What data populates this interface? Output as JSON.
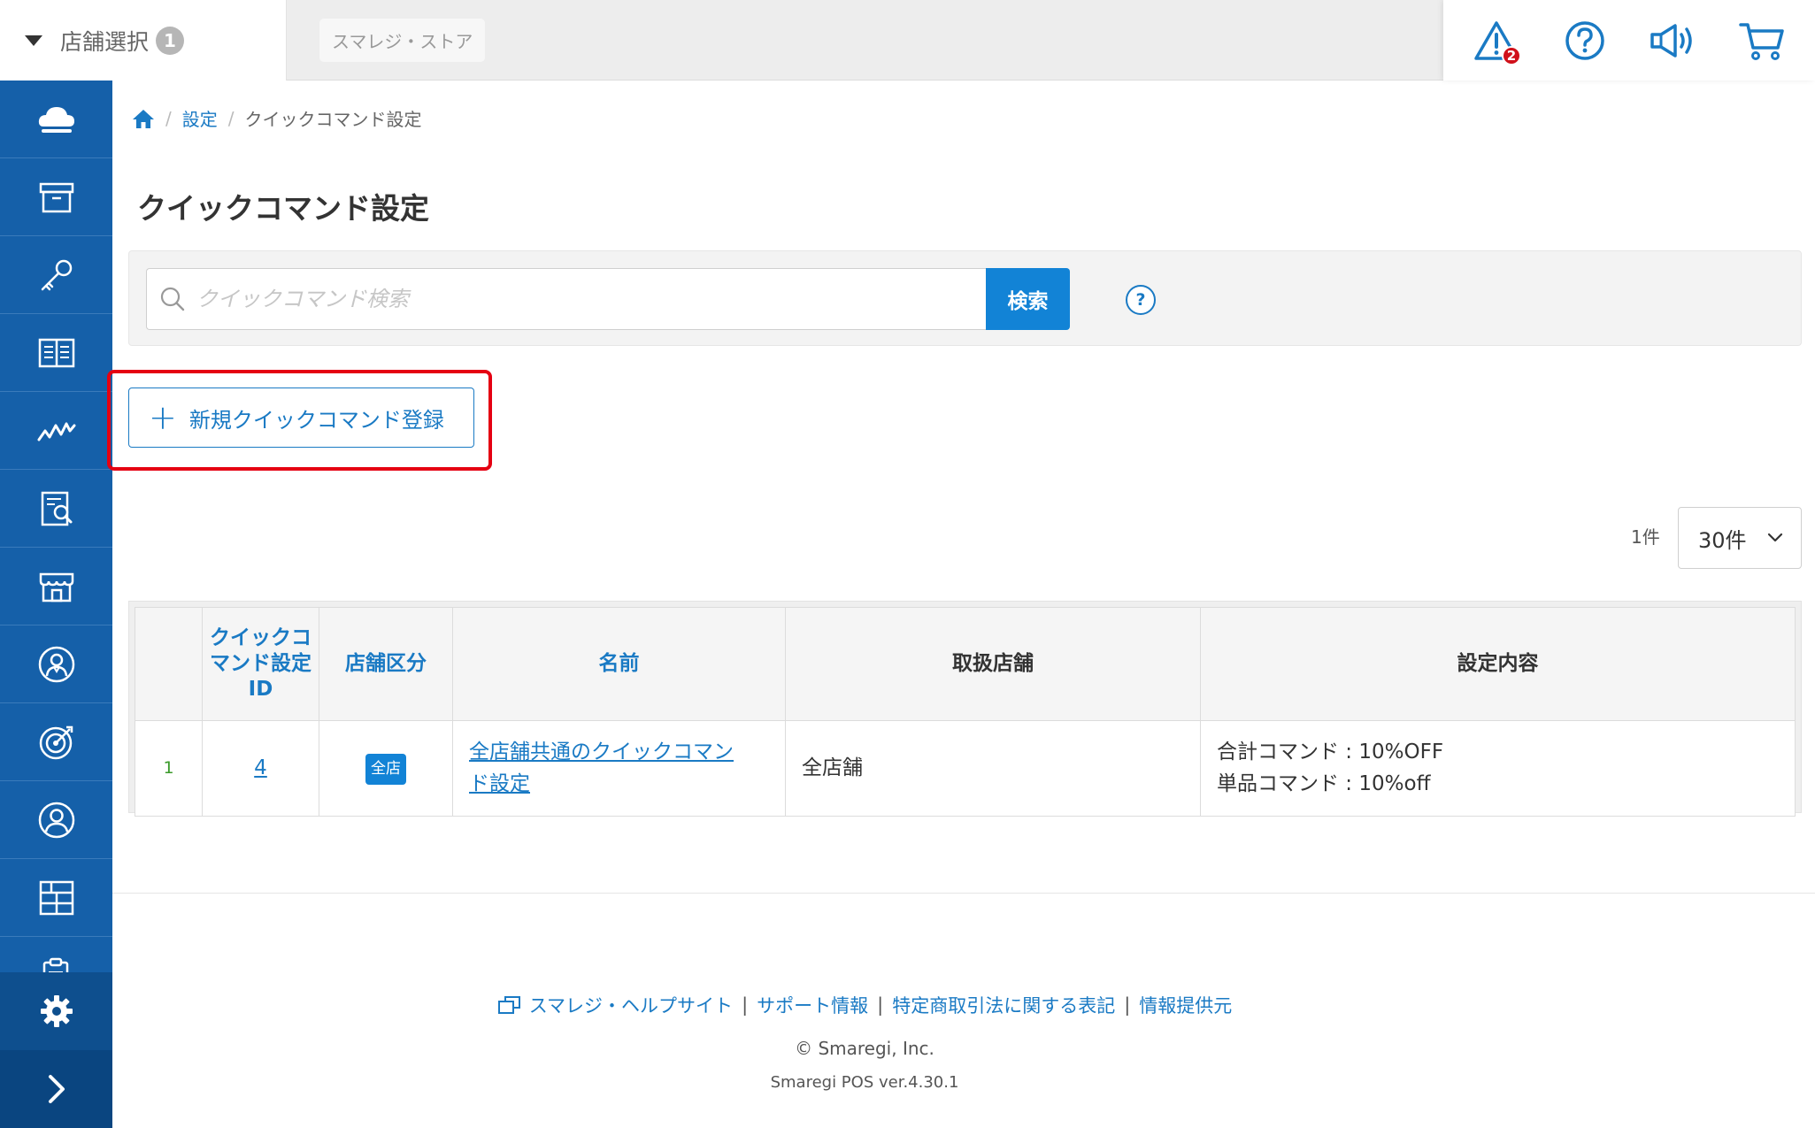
{
  "topbar": {
    "store_select_label": "店舗選択",
    "store_count": "1",
    "store_chip": "スマレジ・ストア",
    "alert_count": "2"
  },
  "sidebar": {
    "items": [
      "cloud-icon",
      "archive-box-icon",
      "key-icon",
      "book-icon",
      "chart-line-icon",
      "report-search-icon",
      "store-icon",
      "staff-icon",
      "target-icon",
      "customer-icon",
      "grid-icon",
      "clipboard-icon"
    ],
    "settings": "gear-icon",
    "expand": "chevron-right-icon"
  },
  "breadcrumb": {
    "settings": "設定",
    "current": "クイックコマンド設定"
  },
  "page_title": "クイックコマンド設定",
  "search": {
    "placeholder": "クイックコマンド検索",
    "button": "検索",
    "help": "?"
  },
  "new_button": {
    "label": "新規クイックコマンド登録"
  },
  "pagination": {
    "count": "1件",
    "per_page": "30件"
  },
  "table": {
    "headers": {
      "id": "クイックコマンド設定ID",
      "id_line1": "クイックコ",
      "id_line2": "マンド設定",
      "id_line3": "ID",
      "store_type": "店舗区分",
      "name": "名前",
      "stores": "取扱店舗",
      "content": "設定内容"
    },
    "rows": [
      {
        "index": "1",
        "id": "4",
        "store_type": "全店",
        "name": "全店舗共通のクイックコマンド設定",
        "name_line1": "全店舗共通のクイックコマン",
        "name_line2": "ド設定",
        "stores": "全店舗",
        "content_line1": "合計コマンド : 10%OFF",
        "content_line2": "単品コマンド : 10%off"
      }
    ]
  },
  "footer": {
    "help_site": "スマレジ・ヘルプサイト",
    "support": "サポート情報",
    "law": "特定商取引法に関する表記",
    "info": "情報提供元",
    "copyright": "© Smaregi, Inc.",
    "version": "Smaregi POS ver.4.30.1"
  },
  "colors": {
    "sidebar": "#1560a9",
    "accent": "#1283d6",
    "link": "#1a7ac4",
    "highlight": "#e50012",
    "alert": "#d0101a"
  }
}
